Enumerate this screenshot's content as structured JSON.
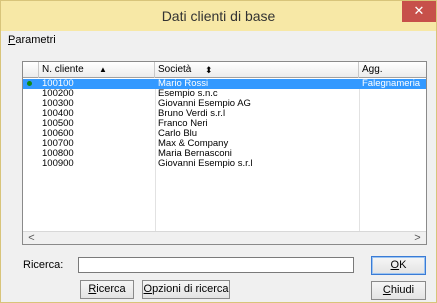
{
  "window": {
    "title": "Dati clienti di base",
    "close_glyph": "✕"
  },
  "menu": {
    "parametri_first": "P",
    "parametri_rest": "arametri"
  },
  "grid": {
    "columns": [
      {
        "label": "N. cliente",
        "sort_glyph": "▲"
      },
      {
        "label": "Società",
        "sort_glyph": "⬍"
      },
      {
        "label": "Agg."
      }
    ],
    "rows": [
      {
        "numero": "100100",
        "societa": "Mario Rossi",
        "agg": "Falegnameria"
      },
      {
        "numero": "100200",
        "societa": "Esempio s.n.c",
        "agg": ""
      },
      {
        "numero": "100300",
        "societa": "Giovanni Esempio AG",
        "agg": ""
      },
      {
        "numero": "100400",
        "societa": "Bruno Verdi s.r.l",
        "agg": ""
      },
      {
        "numero": "100500",
        "societa": "Franco Neri",
        "agg": ""
      },
      {
        "numero": "100600",
        "societa": "Carlo Blu",
        "agg": ""
      },
      {
        "numero": "100700",
        "societa": "Max & Company",
        "agg": ""
      },
      {
        "numero": "100800",
        "societa": "Maria Bernasconi",
        "agg": ""
      },
      {
        "numero": "100900",
        "societa": "Giovanni Esempio s.r.l",
        "agg": ""
      }
    ],
    "selected_row": 0,
    "scroll_left_glyph": "<",
    "scroll_right_glyph": ">"
  },
  "search": {
    "label": "Ricerca:",
    "value": "",
    "placeholder": ""
  },
  "buttons": {
    "ok_first": "O",
    "ok_rest": "K",
    "ricerca_first": "R",
    "ricerca_rest": "icerca",
    "opzioni_first": "O",
    "opzioni_rest": "pzioni di ricerca",
    "chiudi_first": "C",
    "chiudi_rest": "hiudi"
  },
  "colors": {
    "titlebar": "#f7e8a6",
    "close": "#c7504a",
    "selection": "#3399ff",
    "indicator": "#128a12"
  }
}
